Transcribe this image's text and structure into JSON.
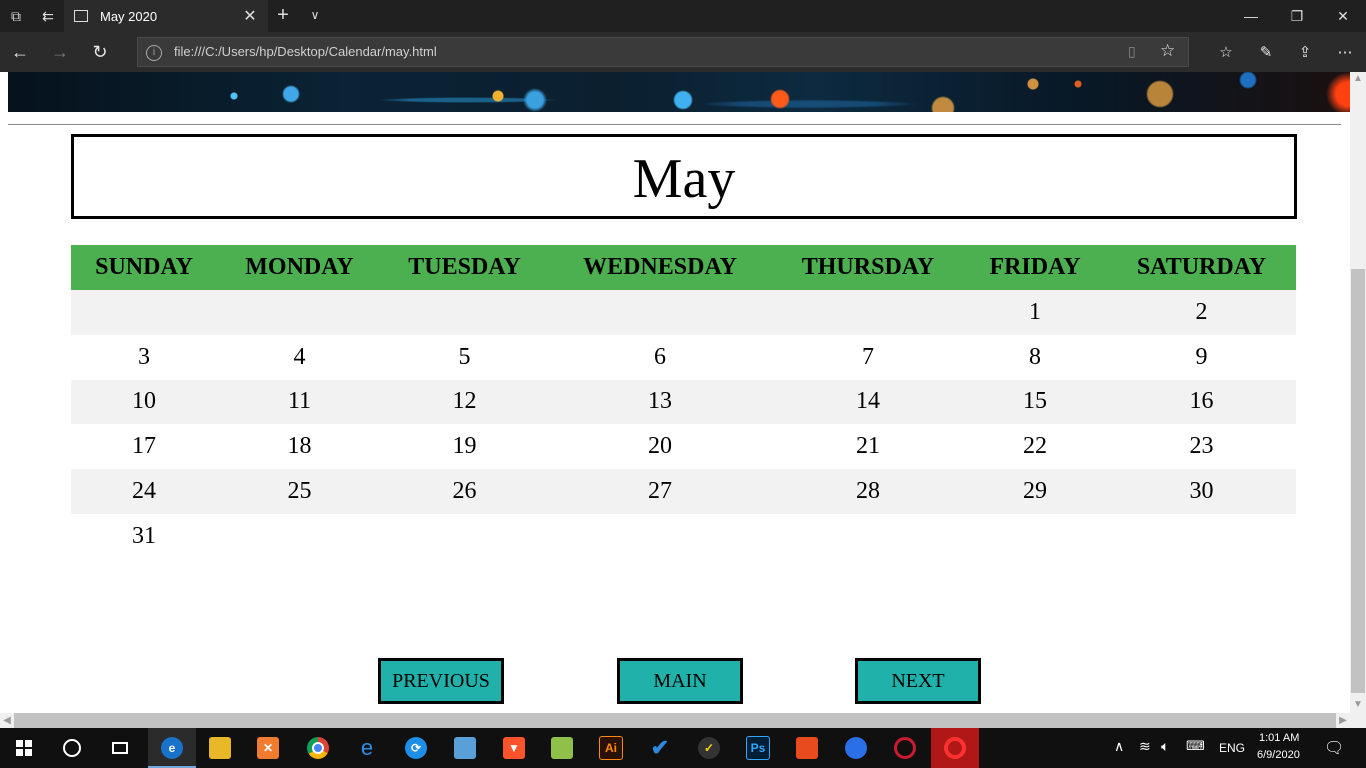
{
  "browser": {
    "tab_title": "May 2020",
    "url": "file:///C:/Users/hp/Desktop/Calendar/may.html"
  },
  "calendar": {
    "month": "May",
    "weekdays": [
      "SUNDAY",
      "MONDAY",
      "TUESDAY",
      "WEDNESDAY",
      "THURSDAY",
      "FRIDAY",
      "SATURDAY"
    ],
    "weeks": [
      [
        "",
        "",
        "",
        "",
        "",
        "1",
        "2"
      ],
      [
        "3",
        "4",
        "5",
        "6",
        "7",
        "8",
        "9"
      ],
      [
        "10",
        "11",
        "12",
        "13",
        "14",
        "15",
        "16"
      ],
      [
        "17",
        "18",
        "19",
        "20",
        "21",
        "22",
        "23"
      ],
      [
        "24",
        "25",
        "26",
        "27",
        "28",
        "29",
        "30"
      ],
      [
        "31",
        "",
        "",
        "",
        "",
        "",
        ""
      ]
    ],
    "header_color": "#4caf50",
    "stripe_color": "#f2f2f2"
  },
  "buttons": {
    "previous": "PREVIOUS",
    "main": "MAIN",
    "next": "NEXT",
    "color": "#20b2aa"
  },
  "taskbar": {
    "apps": [
      "edge-icon",
      "file-explorer-icon",
      "xampp-icon",
      "chrome-icon",
      "internet-explorer-icon",
      "sync-icon",
      "laptop-icon",
      "brave-icon",
      "notepad-plus-plus-icon",
      "illustrator-icon",
      "todo-icon",
      "norton-icon",
      "photoshop-icon",
      "office-icon",
      "firefox-icon",
      "opera-icon",
      "opera-gx-icon"
    ],
    "language": "ENG",
    "time": "1:01 AM",
    "date": "6/9/2020"
  }
}
